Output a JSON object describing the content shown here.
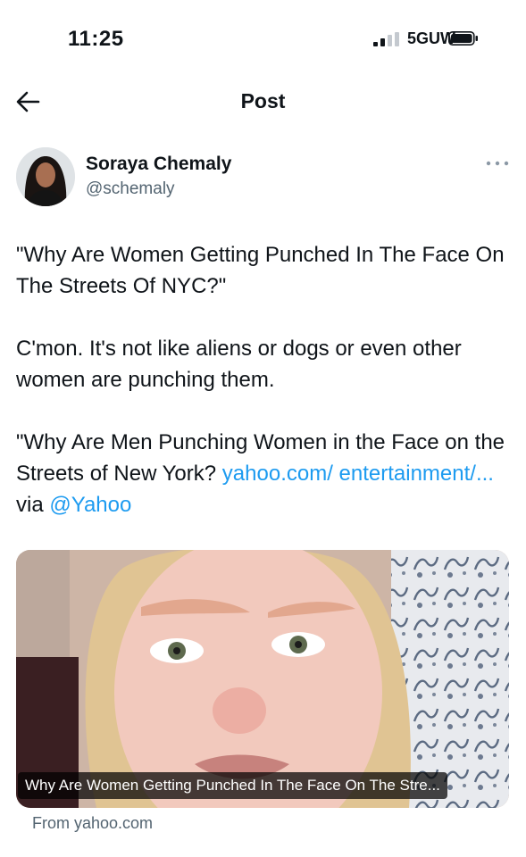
{
  "status_bar": {
    "time": "11:25",
    "network": "5GUW"
  },
  "header": {
    "title": "Post"
  },
  "author": {
    "name": "Soraya Chemaly",
    "handle": "@schemaly"
  },
  "post": {
    "paragraph1": "\"Why Are Women Getting Punched In The Face On The Streets Of NYC?\"",
    "paragraph2": "C'mon. It's not like aliens or dogs or even other women are punching them.",
    "paragraph3_text": "\"Why Are Men Punching Women in the Face on the Streets of New York?",
    "paragraph3_link": "yahoo.com/ entertainment/...",
    "paragraph3_via": "via",
    "paragraph3_mention": "@Yahoo"
  },
  "media": {
    "caption": "Why Are Women Getting Punched In The Face On The Stre...",
    "source": "From yahoo.com"
  },
  "colors": {
    "link": "#1d9bf0",
    "secondary_text": "#536471"
  },
  "icons": [
    "back-arrow-icon",
    "signal-icon",
    "battery-icon",
    "more-icon"
  ]
}
